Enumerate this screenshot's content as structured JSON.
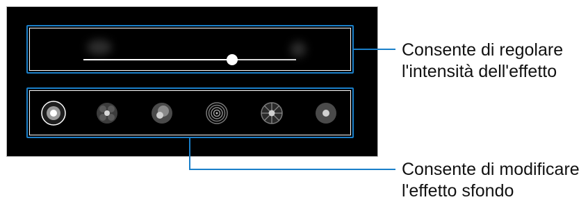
{
  "slider": {
    "value": 0.7
  },
  "effects": [
    {
      "icon": "blur-effect-icon",
      "selected": true
    },
    {
      "icon": "big-circle-effect-icon",
      "selected": false
    },
    {
      "icon": "color-point-effect-icon",
      "selected": false
    },
    {
      "icon": "spin-effect-icon",
      "selected": false
    },
    {
      "icon": "zoom-effect-icon",
      "selected": false
    },
    {
      "icon": "mono-effect-icon",
      "selected": false
    }
  ],
  "callouts": {
    "intensity": {
      "line1": "Consente di regolare",
      "line2": "l'intensità dell'effetto"
    },
    "background": {
      "line1": "Consente di modificare",
      "line2": "l'effetto sfondo"
    }
  },
  "colors": {
    "callout_line": "#1a7fc9",
    "panel_background": "#000000"
  }
}
